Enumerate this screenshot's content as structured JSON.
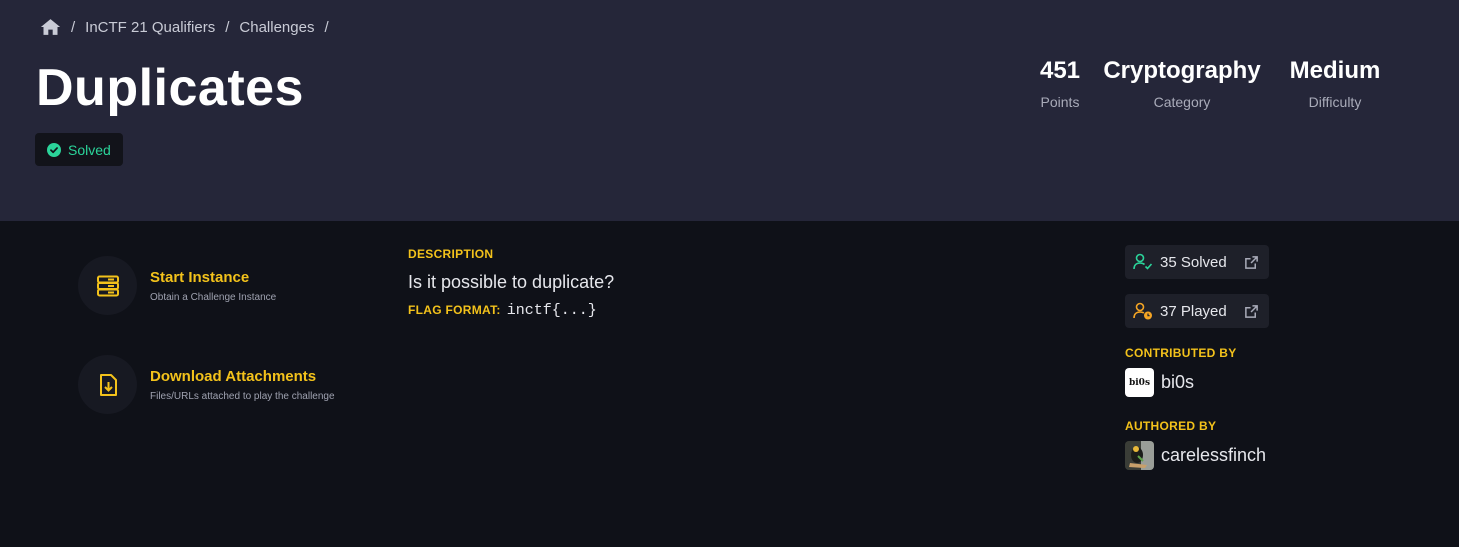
{
  "breadcrumb": {
    "home_icon": "home-icon",
    "items": [
      "InCTF 21 Qualifiers",
      "Challenges"
    ],
    "separator": "/"
  },
  "challenge": {
    "title": "Duplicates",
    "status": "Solved",
    "status_color": "#2bd49a"
  },
  "stats": [
    {
      "value": "451",
      "label": "Points"
    },
    {
      "value": "Cryptography",
      "label": "Category"
    },
    {
      "value": "Medium",
      "label": "Difficulty"
    }
  ],
  "actions": [
    {
      "title": "Start Instance",
      "subtitle": "Obtain a Challenge Instance",
      "icon": "server-icon"
    },
    {
      "title": "Download Attachments",
      "subtitle": "Files/URLs attached to play the challenge",
      "icon": "download-file-icon"
    }
  ],
  "description": {
    "heading": "DESCRIPTION",
    "text": "Is it possible to duplicate?",
    "flag_label": "FLAG FORMAT:",
    "flag_value": "inctf{...}"
  },
  "sidebar": {
    "solved": "35 Solved",
    "played": "37 Played",
    "contributed_heading": "CONTRIBUTED BY",
    "contributor": "bi0s",
    "contributor_logo_text": "bi0s",
    "authored_heading": "AUTHORED BY",
    "author": "carelessfinch"
  },
  "colors": {
    "accent": "#f3c21b",
    "hero_bg": "#252639",
    "page_bg": "#0f1118",
    "success": "#2bd49a",
    "warning": "#f5a524"
  }
}
